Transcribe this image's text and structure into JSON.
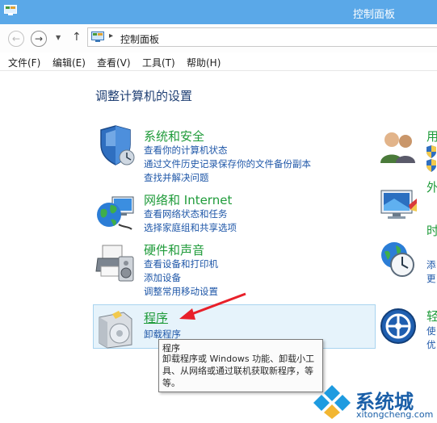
{
  "window": {
    "title": "控制面板"
  },
  "address": {
    "path": "控制面板"
  },
  "menu": [
    "文件(F)",
    "编辑(E)",
    "查看(V)",
    "工具(T)",
    "帮助(H)"
  ],
  "heading": "调整计算机的设置",
  "categories": [
    {
      "title": "系统和安全",
      "links": [
        "查看你的计算机状态",
        "通过文件历史记录保存你的文件备份副本",
        "查找并解决问题"
      ]
    },
    {
      "title": "网络和 Internet",
      "links": [
        "查看网络状态和任务",
        "选择家庭组和共享选项"
      ]
    },
    {
      "title": "硬件和声音",
      "links": [
        "查看设备和打印机",
        "添加设备",
        "调整常用移动设置"
      ]
    },
    {
      "title": "程序",
      "links": [
        "卸载程序"
      ]
    }
  ],
  "right_column": {
    "items": [
      {
        "title": "用",
        "links": []
      },
      {
        "title": "外",
        "links": []
      },
      {
        "title": "时",
        "links": [
          "添",
          "更"
        ]
      },
      {
        "title": "轻",
        "links": [
          "使",
          "优"
        ]
      }
    ]
  },
  "tooltip": {
    "title": "程序",
    "description": "卸载程序或 Windows 功能、卸载小工具、从网络或通过联机获取新程序，等等。"
  },
  "watermark": {
    "text": "系统城",
    "url": "xitongcheng.com"
  },
  "colors": {
    "titlebar": "#5aa8e8",
    "category_title": "#1f9b3a",
    "link": "#1f57a8",
    "arrow": "#e8202a"
  },
  "icons": [
    "control-panel-icon",
    "back-arrow-icon",
    "forward-arrow-icon",
    "chevron-down-icon",
    "up-arrow-icon",
    "shield-icon",
    "network-globe-icon",
    "printer-icon",
    "programs-icon",
    "users-icon",
    "appearance-icon",
    "clock-globe-icon",
    "ease-of-access-icon",
    "uac-shield-icon"
  ]
}
